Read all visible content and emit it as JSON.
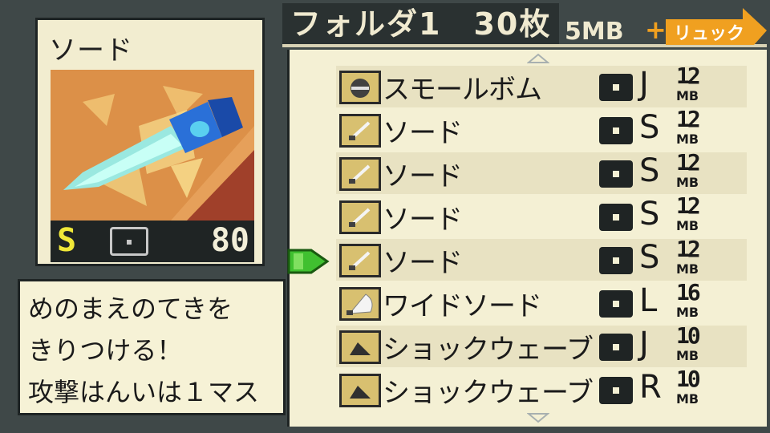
{
  "selected_chip": {
    "name": "ソード",
    "code": "S",
    "power": "80",
    "element_icon": "normal-element-icon",
    "description": [
      "めのまえのてきを",
      "きりつける！",
      "攻撃はんいは１マス"
    ]
  },
  "header": {
    "folder_title": "フォルダ1　30枚",
    "mb_total": "5MB",
    "plus": "+",
    "rucksack_label": "リュック"
  },
  "chips": [
    {
      "name": "スモールボム",
      "code": "J",
      "mb": "12",
      "unit": "MB",
      "icon": "bomb-icon"
    },
    {
      "name": "ソード",
      "code": "S",
      "mb": "12",
      "unit": "MB",
      "icon": "sword-icon"
    },
    {
      "name": "ソード",
      "code": "S",
      "mb": "12",
      "unit": "MB",
      "icon": "sword-icon"
    },
    {
      "name": "ソード",
      "code": "S",
      "mb": "12",
      "unit": "MB",
      "icon": "sword-icon"
    },
    {
      "name": "ソード",
      "code": "S",
      "mb": "12",
      "unit": "MB",
      "icon": "sword-icon"
    },
    {
      "name": "ワイドソード",
      "code": "L",
      "mb": "16",
      "unit": "MB",
      "icon": "wide-sword-icon"
    },
    {
      "name": "ショックウェーブ",
      "code": "J",
      "mb": "10",
      "unit": "MB",
      "icon": "shockwave-icon"
    },
    {
      "name": "ショックウェーブ",
      "code": "R",
      "mb": "10",
      "unit": "MB",
      "icon": "shockwave-icon"
    }
  ],
  "cursor_row": 5,
  "colors": {
    "background": "#3f4848",
    "panel": "#f4f0d4",
    "code_yellow": "#f0e838",
    "rucksack_orange": "#f0a020",
    "cursor_green": "#40c030"
  }
}
